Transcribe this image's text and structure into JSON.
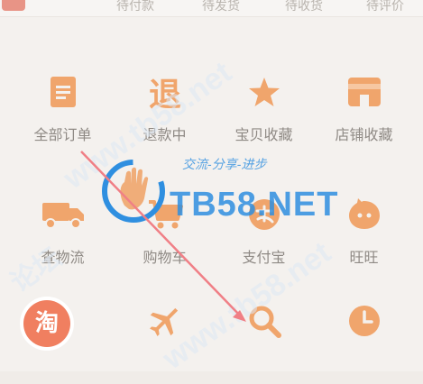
{
  "top_tabs": [
    "待付款",
    "待发货",
    "待收货",
    "待评价"
  ],
  "grid": [
    {
      "label": "全部订单",
      "icon": "order-list-icon"
    },
    {
      "label": "退款中",
      "icon": "refund-icon",
      "glyph": "退"
    },
    {
      "label": "宝贝收藏",
      "icon": "star-icon"
    },
    {
      "label": "店铺收藏",
      "icon": "shop-icon"
    },
    {
      "label": "查物流",
      "icon": "truck-icon"
    },
    {
      "label": "购物车",
      "icon": "cart-icon"
    },
    {
      "label": "支付宝",
      "icon": "alipay-icon"
    },
    {
      "label": "旺旺",
      "icon": "wangwang-icon"
    },
    {
      "label": "",
      "icon": "taobao-icon",
      "glyph": "淘"
    },
    {
      "label": "",
      "icon": "airplane-icon"
    },
    {
      "label": "",
      "icon": "search-icon"
    },
    {
      "label": "",
      "icon": "clock-icon"
    }
  ],
  "watermark": {
    "brand": "TB58.NET",
    "slogan": "交流-分享-进步",
    "site": "www.tb58.net",
    "forum": "论坛"
  },
  "colors": {
    "icon": "#f0a56c",
    "label": "#8f8a85",
    "background": "#f4f1ee",
    "arrow": "#f07f86",
    "watermark_blue": "#2f8fe0"
  }
}
